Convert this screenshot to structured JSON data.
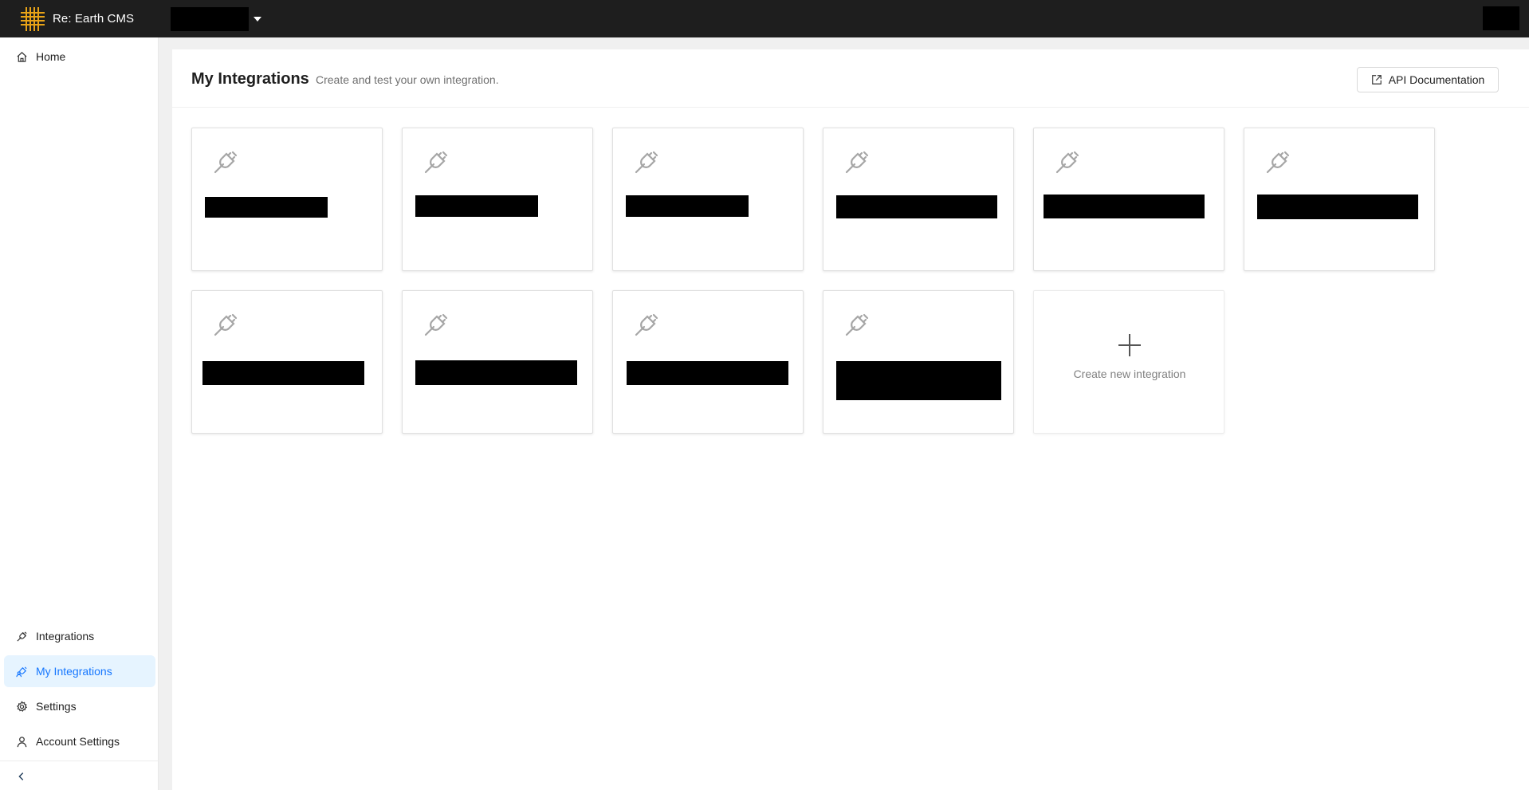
{
  "header": {
    "app_name": "Re: Earth CMS",
    "logo_icon": "grid-logo-icon",
    "workspace_selector_value": "",
    "user_menu_value": ""
  },
  "sidebar": {
    "top_items": [
      {
        "label": "Home",
        "icon": "home-icon"
      }
    ],
    "bottom_items": [
      {
        "label": "Integrations",
        "icon": "plug-icon"
      },
      {
        "label": "My Integrations",
        "icon": "user-plug-icon",
        "active": true
      },
      {
        "label": "Settings",
        "icon": "gear-icon"
      },
      {
        "label": "Account Settings",
        "icon": "user-icon"
      }
    ],
    "collapse_icon": "chevron-left-icon"
  },
  "page": {
    "title": "My Integrations",
    "subtitle": "Create and test your own integration.",
    "api_button_label": "API Documentation"
  },
  "integrations": [
    {
      "name": ""
    },
    {
      "name": ""
    },
    {
      "name": ""
    },
    {
      "name": ""
    },
    {
      "name": ""
    },
    {
      "name": ""
    },
    {
      "name": ""
    },
    {
      "name": ""
    },
    {
      "name": ""
    },
    {
      "name": ""
    }
  ],
  "create_card": {
    "label": "Create new integration",
    "icon": "plus-icon"
  },
  "colors": {
    "header_bg": "#1e1e1e",
    "logo_accent": "#e8a317",
    "active_bg": "#e6f4ff",
    "active_text": "#1677ff",
    "icon_gray": "#a6a6a6"
  }
}
